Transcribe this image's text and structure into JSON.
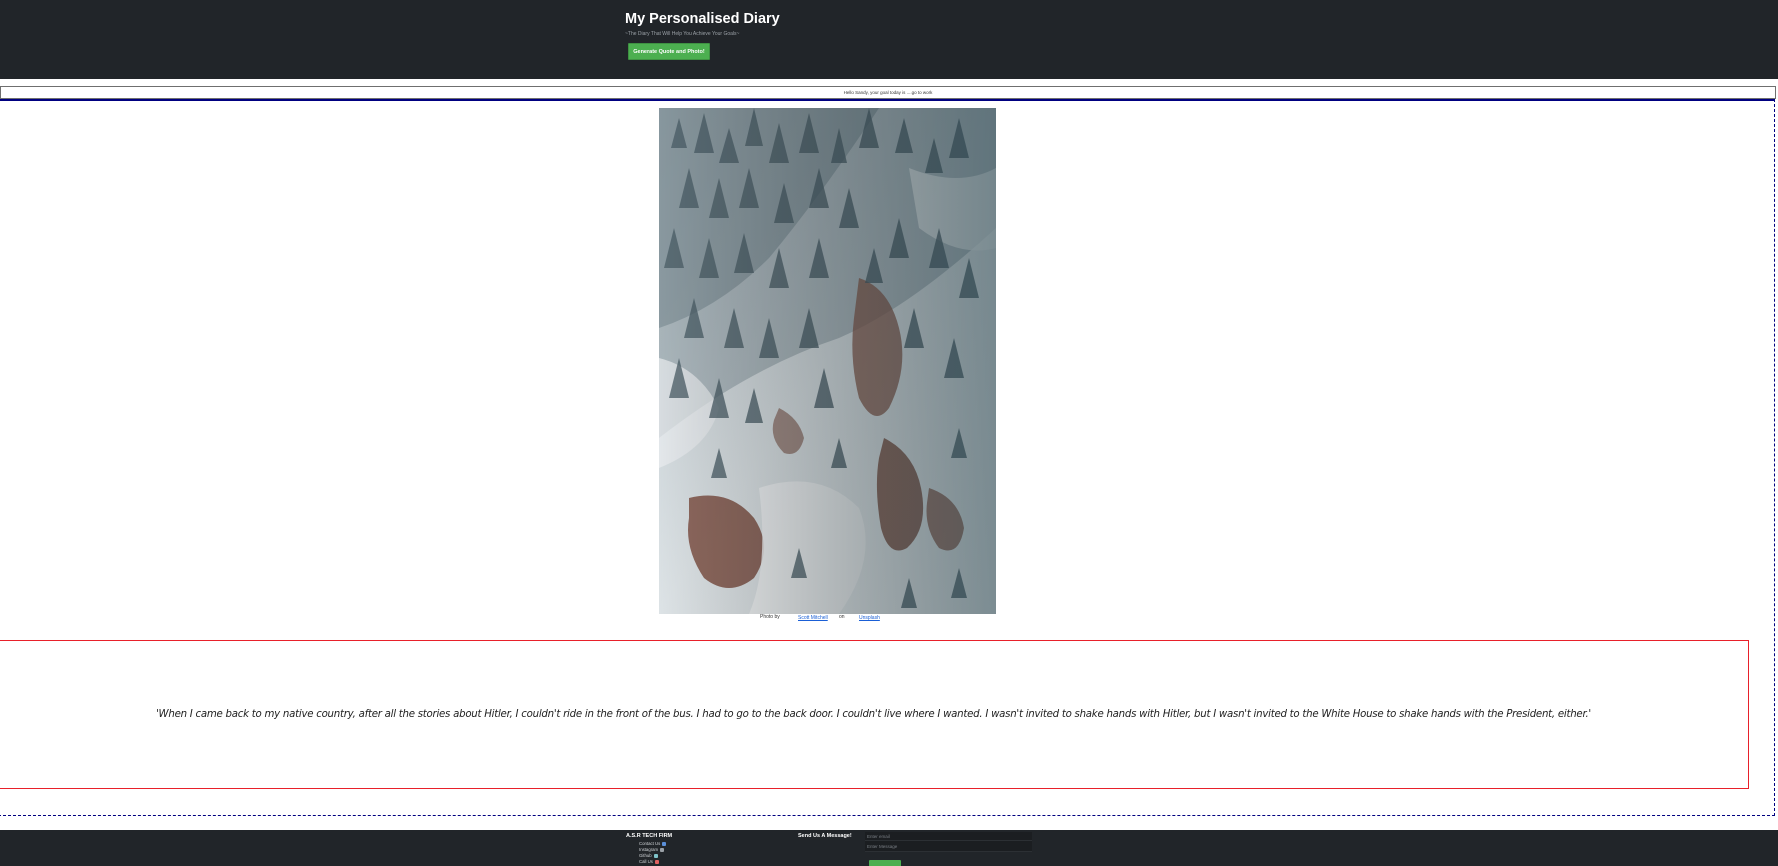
{
  "header": {
    "title": "My Personalised Diary",
    "subtitle": "~The Diary That Will Help You Achieve Your Goals~",
    "generate_button_label": "Generate Quote and Photo!"
  },
  "goal_bar": {
    "text": "Hello Sandy, your goal today is ....go to work"
  },
  "photo": {
    "alt": "Snow covered forest on a mountainside",
    "credit_prefix": "Photo by",
    "photographer": "Scott Mitchell",
    "credit_separator": "on",
    "source": "Unsplash"
  },
  "quote": {
    "text": "'When I came back to my native country, after all the stories about Hitler, I couldn't ride in the front of the bus. I had to go to the back door. I couldn't live where I wanted. I wasn't invited to shake hands with Hitler, but I wasn't invited to the White House to shake hands with the President, either.'"
  },
  "footer": {
    "brand": "A.S.R TECH FIRM",
    "links": [
      {
        "label": "Contact Us",
        "icon": "contact-icon",
        "color": "#5b8fd8"
      },
      {
        "label": "Instagram",
        "icon": "instagram-icon",
        "color": "#9aa0a6"
      },
      {
        "label": "Github",
        "icon": "github-icon",
        "color": "#7fc3c9"
      },
      {
        "label": "Call Us",
        "icon": "phone-icon",
        "color": "#e06060"
      }
    ],
    "form_title": "Send Us A Message!",
    "email_placeholder": "Enter email",
    "message_placeholder": "Enter Message"
  },
  "colors": {
    "header_bg": "#212529",
    "accent_green": "#4caf50",
    "quote_border": "#e8202a",
    "frame_border": "#000080"
  }
}
